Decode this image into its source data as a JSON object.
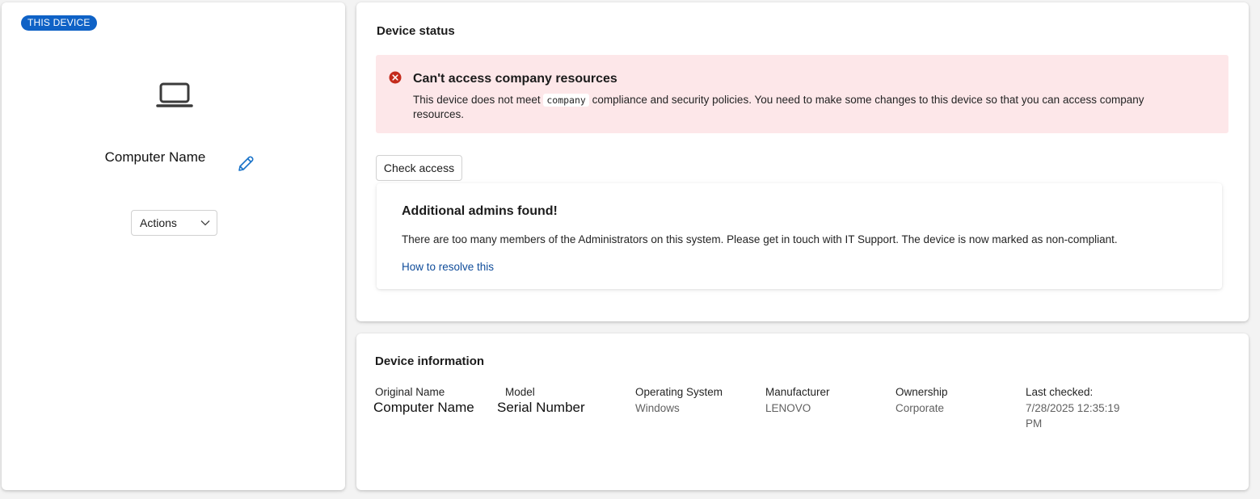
{
  "device_panel": {
    "badge": "THIS DEVICE",
    "device_icon": "laptop-icon",
    "computer_name": "Computer Name",
    "edit_icon": "pencil-icon",
    "actions_label": "Actions",
    "actions_icon": "chevron-down-icon"
  },
  "device_status": {
    "title": "Device status",
    "alert": {
      "icon": "error-circle-icon",
      "title": "Can't access company resources",
      "text_before": "This device does not meet",
      "code": "company",
      "text_after": "compliance and security policies. You need to make some changes to this device so that you can access company resources."
    },
    "check_access_label": "Check access",
    "issue": {
      "title": "Additional admins found!",
      "description": "There are too many members of the Administrators on this system. Please get in touch with IT Support. The device is now marked as non-compliant.",
      "link_text": "How to resolve this"
    }
  },
  "device_information": {
    "title": "Device information",
    "fields": {
      "original_name": {
        "label": "Original Name",
        "value": "Computer Name"
      },
      "model": {
        "label": "Model",
        "value": "Serial Number"
      },
      "os": {
        "label": "Operating System",
        "value": "Windows"
      },
      "manufacturer": {
        "label": "Manufacturer",
        "value": "LENOVO"
      },
      "ownership": {
        "label": "Ownership",
        "value": "Corporate"
      },
      "last_checked": {
        "label": "Last checked:",
        "value": "7/28/2025 12:35:19 PM"
      }
    }
  },
  "colors": {
    "accent": "#0f62c6",
    "error": "#c42b1c",
    "alert_background": "#fde7e9",
    "link": "#0f4c9a"
  }
}
